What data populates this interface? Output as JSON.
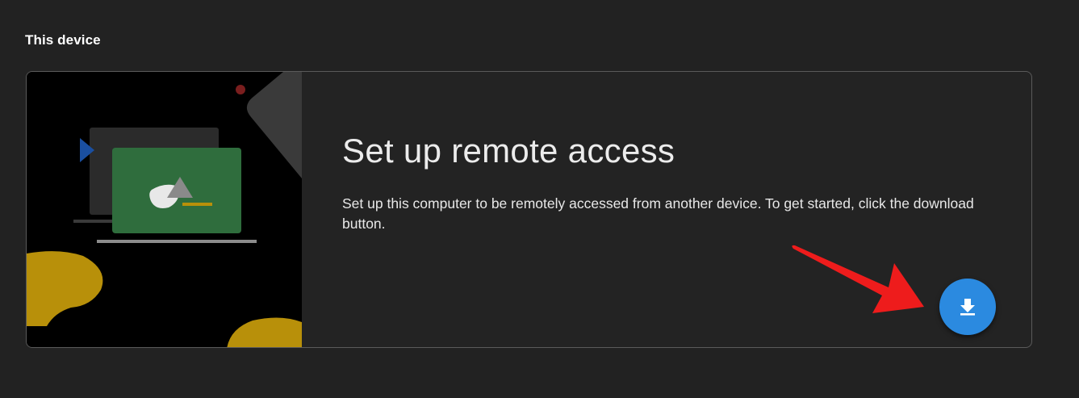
{
  "section": {
    "title": "This device"
  },
  "card": {
    "title": "Set up remote access",
    "description": "Set up this computer to be remotely accessed from another device. To get started, click the download button.",
    "download_button": {
      "icon": "download-icon",
      "color": "#2b8ae0"
    }
  },
  "illustration": {
    "icon": "remote-desktop-illustration",
    "colors": {
      "background": "#000000",
      "screen": "#2f6d3d",
      "blob": "#b8900a",
      "accent": "#1a4fa0"
    }
  },
  "annotation": {
    "icon": "red-arrow-pointer",
    "color": "#ee1c1c"
  }
}
